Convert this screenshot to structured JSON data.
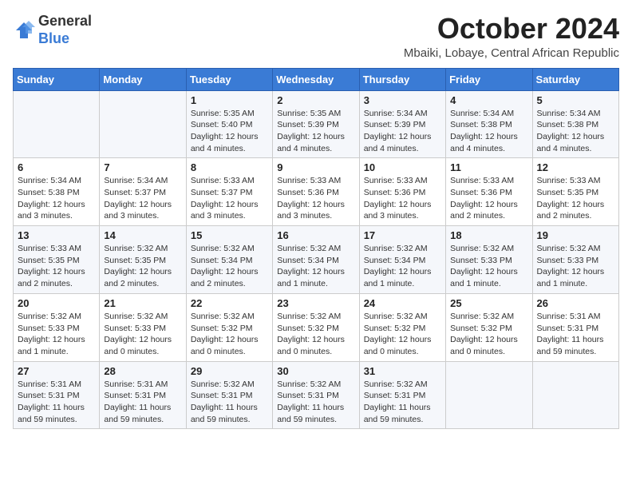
{
  "header": {
    "logo": {
      "general": "General",
      "blue": "Blue"
    },
    "month": "October 2024",
    "location": "Mbaiki, Lobaye, Central African Republic"
  },
  "weekdays": [
    "Sunday",
    "Monday",
    "Tuesday",
    "Wednesday",
    "Thursday",
    "Friday",
    "Saturday"
  ],
  "weeks": [
    [
      {
        "day": "",
        "info": ""
      },
      {
        "day": "",
        "info": ""
      },
      {
        "day": "1",
        "info": "Sunrise: 5:35 AM\nSunset: 5:40 PM\nDaylight: 12 hours and 4 minutes."
      },
      {
        "day": "2",
        "info": "Sunrise: 5:35 AM\nSunset: 5:39 PM\nDaylight: 12 hours and 4 minutes."
      },
      {
        "day": "3",
        "info": "Sunrise: 5:34 AM\nSunset: 5:39 PM\nDaylight: 12 hours and 4 minutes."
      },
      {
        "day": "4",
        "info": "Sunrise: 5:34 AM\nSunset: 5:38 PM\nDaylight: 12 hours and 4 minutes."
      },
      {
        "day": "5",
        "info": "Sunrise: 5:34 AM\nSunset: 5:38 PM\nDaylight: 12 hours and 4 minutes."
      }
    ],
    [
      {
        "day": "6",
        "info": "Sunrise: 5:34 AM\nSunset: 5:38 PM\nDaylight: 12 hours and 3 minutes."
      },
      {
        "day": "7",
        "info": "Sunrise: 5:34 AM\nSunset: 5:37 PM\nDaylight: 12 hours and 3 minutes."
      },
      {
        "day": "8",
        "info": "Sunrise: 5:33 AM\nSunset: 5:37 PM\nDaylight: 12 hours and 3 minutes."
      },
      {
        "day": "9",
        "info": "Sunrise: 5:33 AM\nSunset: 5:36 PM\nDaylight: 12 hours and 3 minutes."
      },
      {
        "day": "10",
        "info": "Sunrise: 5:33 AM\nSunset: 5:36 PM\nDaylight: 12 hours and 3 minutes."
      },
      {
        "day": "11",
        "info": "Sunrise: 5:33 AM\nSunset: 5:36 PM\nDaylight: 12 hours and 2 minutes."
      },
      {
        "day": "12",
        "info": "Sunrise: 5:33 AM\nSunset: 5:35 PM\nDaylight: 12 hours and 2 minutes."
      }
    ],
    [
      {
        "day": "13",
        "info": "Sunrise: 5:33 AM\nSunset: 5:35 PM\nDaylight: 12 hours and 2 minutes."
      },
      {
        "day": "14",
        "info": "Sunrise: 5:32 AM\nSunset: 5:35 PM\nDaylight: 12 hours and 2 minutes."
      },
      {
        "day": "15",
        "info": "Sunrise: 5:32 AM\nSunset: 5:34 PM\nDaylight: 12 hours and 2 minutes."
      },
      {
        "day": "16",
        "info": "Sunrise: 5:32 AM\nSunset: 5:34 PM\nDaylight: 12 hours and 1 minute."
      },
      {
        "day": "17",
        "info": "Sunrise: 5:32 AM\nSunset: 5:34 PM\nDaylight: 12 hours and 1 minute."
      },
      {
        "day": "18",
        "info": "Sunrise: 5:32 AM\nSunset: 5:33 PM\nDaylight: 12 hours and 1 minute."
      },
      {
        "day": "19",
        "info": "Sunrise: 5:32 AM\nSunset: 5:33 PM\nDaylight: 12 hours and 1 minute."
      }
    ],
    [
      {
        "day": "20",
        "info": "Sunrise: 5:32 AM\nSunset: 5:33 PM\nDaylight: 12 hours and 1 minute."
      },
      {
        "day": "21",
        "info": "Sunrise: 5:32 AM\nSunset: 5:33 PM\nDaylight: 12 hours and 0 minutes."
      },
      {
        "day": "22",
        "info": "Sunrise: 5:32 AM\nSunset: 5:32 PM\nDaylight: 12 hours and 0 minutes."
      },
      {
        "day": "23",
        "info": "Sunrise: 5:32 AM\nSunset: 5:32 PM\nDaylight: 12 hours and 0 minutes."
      },
      {
        "day": "24",
        "info": "Sunrise: 5:32 AM\nSunset: 5:32 PM\nDaylight: 12 hours and 0 minutes."
      },
      {
        "day": "25",
        "info": "Sunrise: 5:32 AM\nSunset: 5:32 PM\nDaylight: 12 hours and 0 minutes."
      },
      {
        "day": "26",
        "info": "Sunrise: 5:31 AM\nSunset: 5:31 PM\nDaylight: 11 hours and 59 minutes."
      }
    ],
    [
      {
        "day": "27",
        "info": "Sunrise: 5:31 AM\nSunset: 5:31 PM\nDaylight: 11 hours and 59 minutes."
      },
      {
        "day": "28",
        "info": "Sunrise: 5:31 AM\nSunset: 5:31 PM\nDaylight: 11 hours and 59 minutes."
      },
      {
        "day": "29",
        "info": "Sunrise: 5:32 AM\nSunset: 5:31 PM\nDaylight: 11 hours and 59 minutes."
      },
      {
        "day": "30",
        "info": "Sunrise: 5:32 AM\nSunset: 5:31 PM\nDaylight: 11 hours and 59 minutes."
      },
      {
        "day": "31",
        "info": "Sunrise: 5:32 AM\nSunset: 5:31 PM\nDaylight: 11 hours and 59 minutes."
      },
      {
        "day": "",
        "info": ""
      },
      {
        "day": "",
        "info": ""
      }
    ]
  ]
}
